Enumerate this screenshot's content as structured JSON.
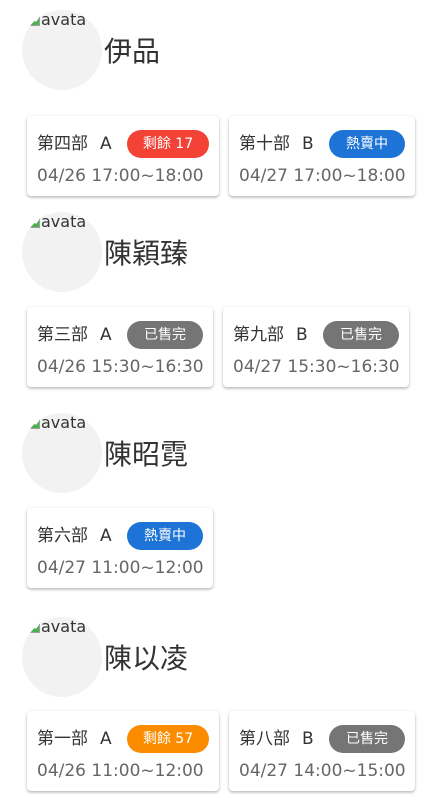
{
  "colors": {
    "red": "#f44336",
    "blue": "#1e74d6",
    "gray": "#757575",
    "orange": "#fb8c00"
  },
  "artists": [
    {
      "name": "伊品",
      "avatar_alt": "avata",
      "shows": [
        {
          "part": "第四部",
          "zone": "A",
          "status": "剩餘 17",
          "status_color": "#f44336",
          "time": "04/26 17:00~18:00"
        },
        {
          "part": "第十部",
          "zone": "B",
          "status": "熱賣中",
          "status_color": "#1e74d6",
          "time": "04/27 17:00~18:00"
        }
      ]
    },
    {
      "name": "陳穎臻",
      "avatar_alt": "avata",
      "shows": [
        {
          "part": "第三部",
          "zone": "A",
          "status": "已售完",
          "status_color": "#757575",
          "time": "04/26 15:30~16:30"
        },
        {
          "part": "第九部",
          "zone": "B",
          "status": "已售完",
          "status_color": "#757575",
          "time": "04/27 15:30~16:30"
        }
      ]
    },
    {
      "name": "陳昭霓",
      "avatar_alt": "avata",
      "shows": [
        {
          "part": "第六部",
          "zone": "A",
          "status": "熱賣中",
          "status_color": "#1e74d6",
          "time": "04/27 11:00~12:00"
        }
      ]
    },
    {
      "name": "陳以凌",
      "avatar_alt": "avata",
      "shows": [
        {
          "part": "第一部",
          "zone": "A",
          "status": "剩餘 57",
          "status_color": "#fb8c00",
          "time": "04/26 11:00~12:00"
        },
        {
          "part": "第八部",
          "zone": "B",
          "status": "已售完",
          "status_color": "#757575",
          "time": "04/27 14:00~15:00"
        }
      ]
    }
  ]
}
